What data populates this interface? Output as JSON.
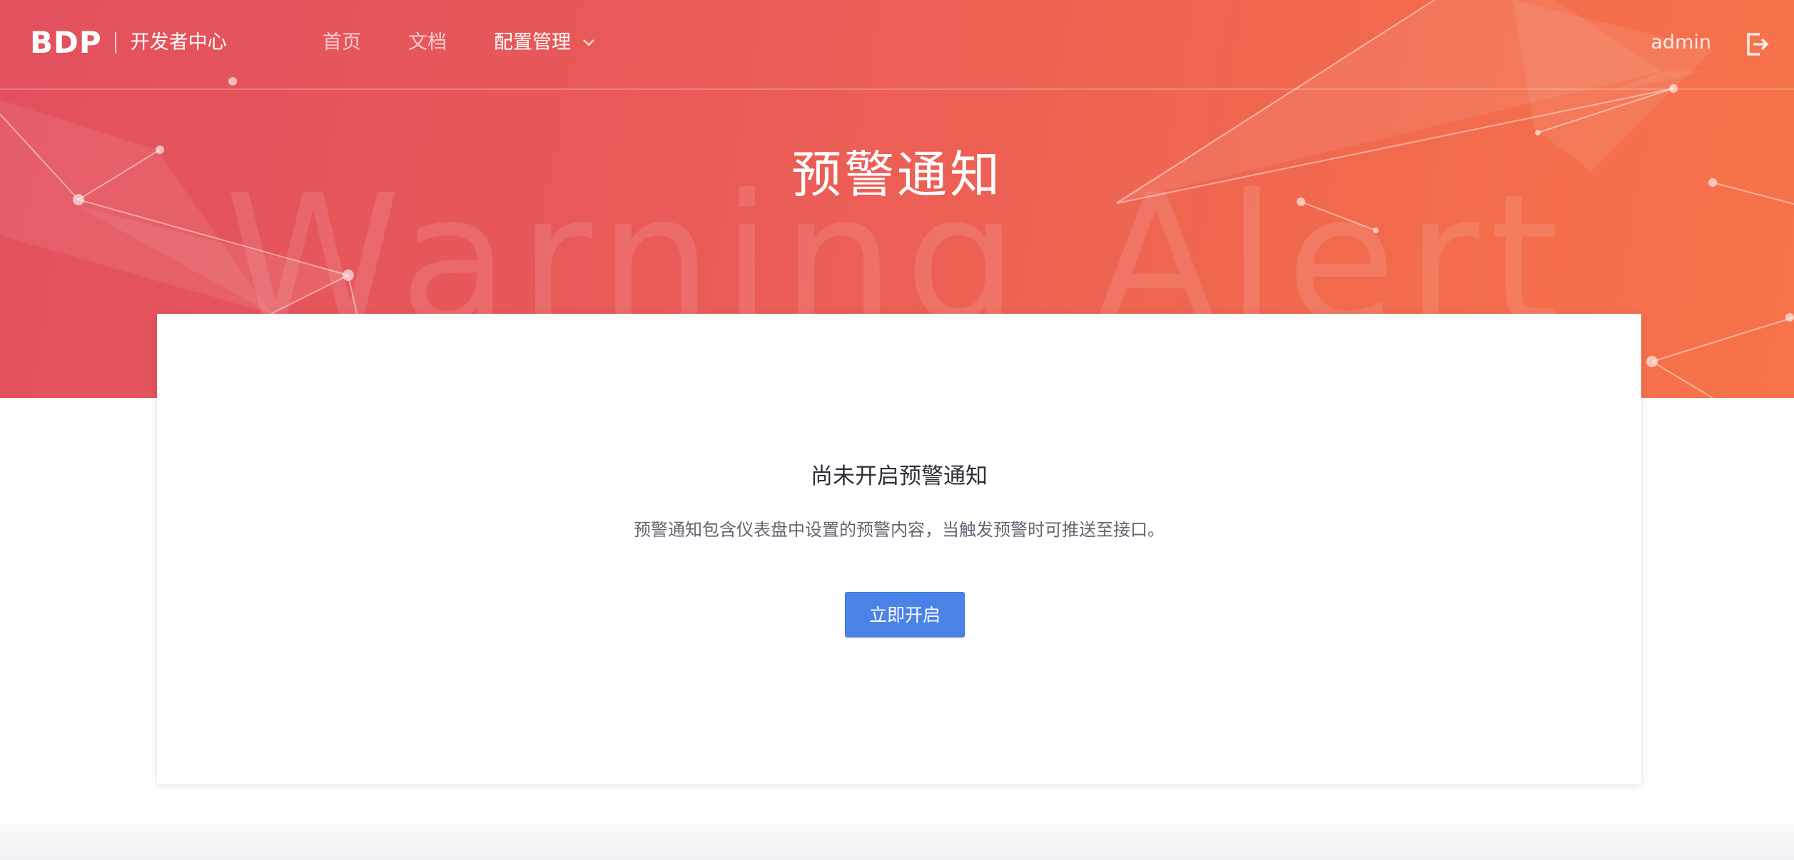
{
  "header": {
    "logo_text": "BDP",
    "logo_subtitle": "开发者中心",
    "nav": {
      "home": "首页",
      "docs": "文档",
      "config": "配置管理"
    },
    "user": "admin",
    "icons": {
      "dropdown": "chevron-down-icon",
      "logout": "logout-icon"
    }
  },
  "hero": {
    "title": "预警通知",
    "watermark": "Warning Alert"
  },
  "card": {
    "title": "尚未开启预警通知",
    "description": "预警通知包含仪表盘中设置的预警内容，当触发预警时可推送至接口。",
    "button_label": "立即开启"
  },
  "colors": {
    "hero_gradient_start": "#e2505e",
    "hero_gradient_end": "#f7744a",
    "primary_button": "#4a82e8"
  }
}
